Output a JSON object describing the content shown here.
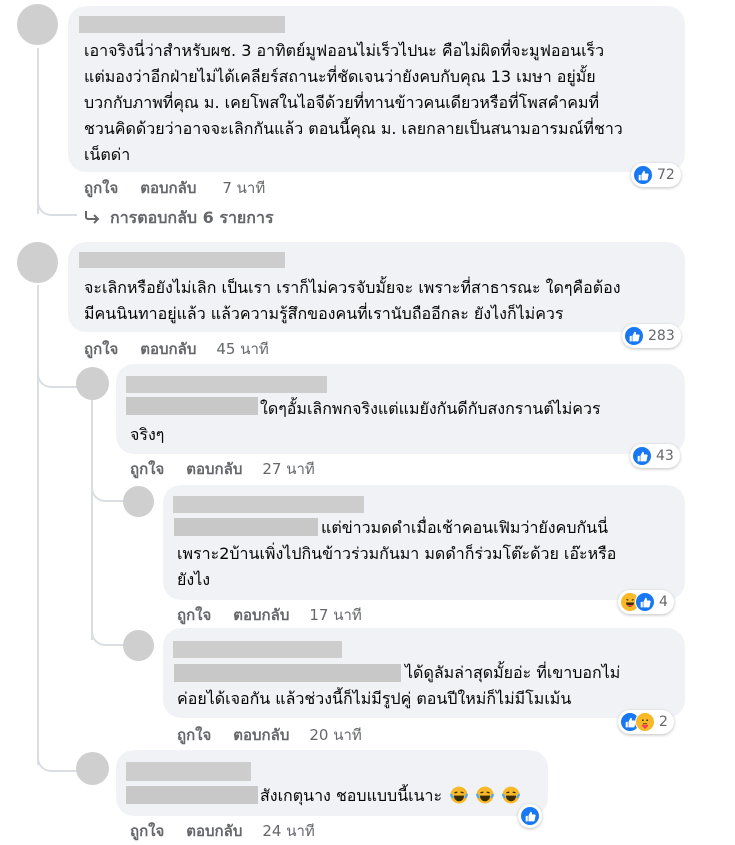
{
  "comments": [
    {
      "text": "เอาจริงนี่ว่าสำหรับผช. 3 อาทิตย์มูฟออนไม่เร็วไปนะ คือไม่ผิดที่จะมูฟออนเร็ว\nแต่มองว่าอีกฝ่ายไม่ได้เคลียร์สถานะที่ชัดเจนว่ายังคบกับคุณ 13 เมษา อยู่มั้ย\nบวกกับภาพที่คุณ ม. เคยโพสในไอจีด้วยที่ทานข้าวคนเดียวหรือที่โพสคำคมที่\nชวนคิดด้วยว่าอาจจะเลิกกันแล้ว ตอนนี้คุณ ม. เลยกลายเป็นสนามอารมณ์ที่ชาว\nเน็ตด่า",
      "like_label": "ถูกใจ",
      "reply_label": "ตอบกลับ",
      "time": "7 นาที",
      "reaction_count": "72",
      "replies_link": "การตอบกลับ 6 รายการ"
    },
    {
      "text": "จะเลิกหรือยังไม่เลิก เป็นเรา เราก็ไม่ควรจับมั้ยจะ เพราะที่สาธารณะ ใดๆคือต้อง\nมีคนนินทาอยู่แล้ว แล้วความรู้สึกของคนที่เรานับถืออีกละ ยังไงก็ไม่ควร",
      "like_label": "ถูกใจ",
      "reply_label": "ตอบกลับ",
      "time": "45 นาที",
      "reaction_count": "283"
    },
    {
      "text": "ใดๆอั้มเลิกพกจริงแต่แมยังกันดีกับสงกรานต์ไม่ควร\nจริงๆ",
      "like_label": "ถูกใจ",
      "reply_label": "ตอบกลับ",
      "time": "27 นาที",
      "reaction_count": "43"
    },
    {
      "text": "แต่ข่าวมดดำเมื่อเช้าคอนเฟิมว่ายังคบกันนี่\nเพราะ2บ้านเพิ่งไปกินข้าวร่วมกันมา มดดำก็ร่วมโต๊ะด้วย เอ๊ะหรือ\nยังไง",
      "like_label": "ถูกใจ",
      "reply_label": "ตอบกลับ",
      "time": "17 นาที",
      "reaction_count": "4"
    },
    {
      "text": "ได้ดูลัมล่าสุดมั้ยอ่ะ ที่เขาบอกไม่\nค่อยได้เจอกัน แล้วช่วงนี้ก็ไม่มีรูปคู่ ตอนปีใหม่ก็ไม่มีโมเม้น",
      "like_label": "ถูกใจ",
      "reply_label": "ตอบกลับ",
      "time": "20 นาที",
      "reaction_count": "2"
    },
    {
      "text": "สังเกตุนาง ชอบแบบนี้เนาะ",
      "like_label": "ถูกใจ",
      "reply_label": "ตอบกลับ",
      "time": "24 นาที"
    }
  ],
  "colors": {
    "bubble": "#f0f2f5",
    "meta": "#65676b",
    "like": "#1877f2",
    "haha": "#f7b928",
    "redaction": "#c8c8c8",
    "avatar": "#cfcfcf",
    "thread_line": "#dadde1"
  },
  "icons": {
    "like": "thumbs-up-icon",
    "haha": "laughing-emoji-icon",
    "care": "care-hug-emoji-icon",
    "tears_of_joy": "tears-of-joy-emoji-icon",
    "reply_arrow": "reply-arrow-icon"
  }
}
